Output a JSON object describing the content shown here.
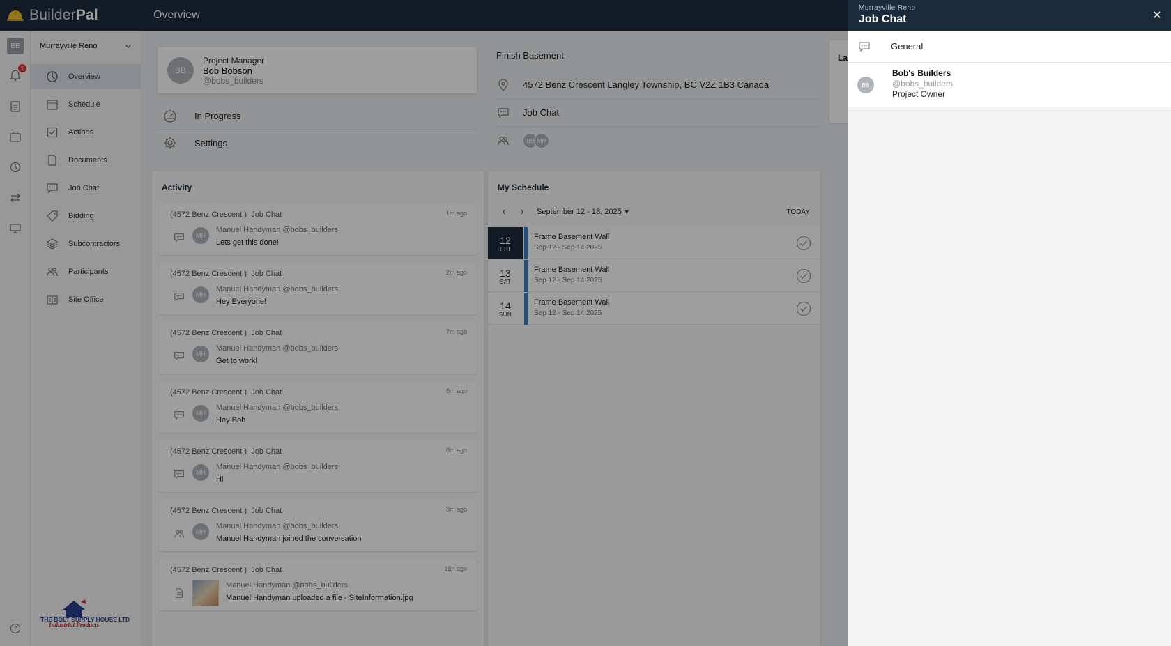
{
  "app": {
    "brand_first": "Builder",
    "brand_second": "Pal",
    "page_title": "Overview"
  },
  "rail": {
    "avatar": "BB",
    "notification_count": "1"
  },
  "sidebar": {
    "project": "Murrayville Reno",
    "items": [
      {
        "label": "Overview",
        "icon": "pie-chart-icon"
      },
      {
        "label": "Schedule",
        "icon": "calendar-icon"
      },
      {
        "label": "Actions",
        "icon": "checkbox-icon"
      },
      {
        "label": "Documents",
        "icon": "document-icon"
      },
      {
        "label": "Job Chat",
        "icon": "chat-icon"
      },
      {
        "label": "Bidding",
        "icon": "tag-icon"
      },
      {
        "label": "Subcontractors",
        "icon": "layers-icon"
      },
      {
        "label": "Participants",
        "icon": "people-icon"
      },
      {
        "label": "Site Office",
        "icon": "site-office-icon"
      }
    ],
    "sponsor_line1": "THE BOLT SUPPLY HOUSE LTD.",
    "sponsor_line2": "Industrial Products"
  },
  "manager": {
    "role": "Project Manager",
    "name": "Bob Bobson",
    "handle": "@bobs_builders",
    "initials": "BB"
  },
  "status": {
    "label": "In Progress",
    "settings": "Settings"
  },
  "job": {
    "title": "Finish Basement",
    "address": "4572 Benz Crescent Langley Township, BC V2Z 1B3 Canada",
    "chat": "Job Chat",
    "participants": [
      "BB",
      "MH"
    ],
    "peek_label": "La"
  },
  "activity": {
    "title": "Activity",
    "items": [
      {
        "project": "(4572 Benz Crescent )",
        "channel": "Job Chat",
        "time": "1m ago",
        "initials": "MH",
        "user": "Manuel Handyman @bobs_builders",
        "message": "Lets get this done!",
        "icon": "chat-icon"
      },
      {
        "project": "(4572 Benz Crescent )",
        "channel": "Job Chat",
        "time": "2m ago",
        "initials": "MH",
        "user": "Manuel Handyman @bobs_builders",
        "message": "Hey Everyone!",
        "icon": "chat-icon"
      },
      {
        "project": "(4572 Benz Crescent )",
        "channel": "Job Chat",
        "time": "7m ago",
        "initials": "MH",
        "user": "Manuel Handyman @bobs_builders",
        "message": "Get to work!",
        "icon": "chat-icon"
      },
      {
        "project": "(4572 Benz Crescent )",
        "channel": "Job Chat",
        "time": "8m ago",
        "initials": "MH",
        "user": "Manuel Handyman @bobs_builders",
        "message": "Hey Bob",
        "icon": "chat-icon"
      },
      {
        "project": "(4572 Benz Crescent )",
        "channel": "Job Chat",
        "time": "8m ago",
        "initials": "MH",
        "user": "Manuel Handyman @bobs_builders",
        "message": "Hi",
        "icon": "chat-icon"
      },
      {
        "project": "(4572 Benz Crescent )",
        "channel": "Job Chat",
        "time": "8m ago",
        "initials": "MH",
        "user": "Manuel Handyman @bobs_builders",
        "message": "Manuel Handyman joined the conversation",
        "icon": "people-icon"
      },
      {
        "project": "(4572 Benz Crescent )",
        "channel": "Job Chat",
        "time": "18h ago",
        "initials": "",
        "user": "Manuel Handyman @bobs_builders",
        "message": "Manuel Handyman uploaded a file - SiteInformation.jpg",
        "icon": "document-icon"
      }
    ]
  },
  "schedule": {
    "title": "My Schedule",
    "range": "September 12 - 18, 2025",
    "today": "TODAY",
    "rows": [
      {
        "day": "12",
        "dow": "FRI",
        "title": "Frame Basement Wall",
        "dates": "Sep 12 - Sep 14 2025"
      },
      {
        "day": "13",
        "dow": "SAT",
        "title": "Frame Basement Wall",
        "dates": "Sep 12 - Sep 14 2025"
      },
      {
        "day": "14",
        "dow": "SUN",
        "title": "Frame Basement Wall",
        "dates": "Sep 12 - Sep 14 2025"
      }
    ]
  },
  "panel": {
    "subtitle": "Murrayville Reno",
    "title": "Job Chat",
    "close": "✕",
    "general": "General",
    "member": {
      "initials": "BB",
      "name": "Bob's Builders",
      "handle": "@bobs_builders",
      "role": "Project Owner"
    }
  },
  "colors": {
    "navy": "#1c2b3c",
    "accent_blue": "#3d7fc1",
    "badge_red": "#e53935"
  }
}
